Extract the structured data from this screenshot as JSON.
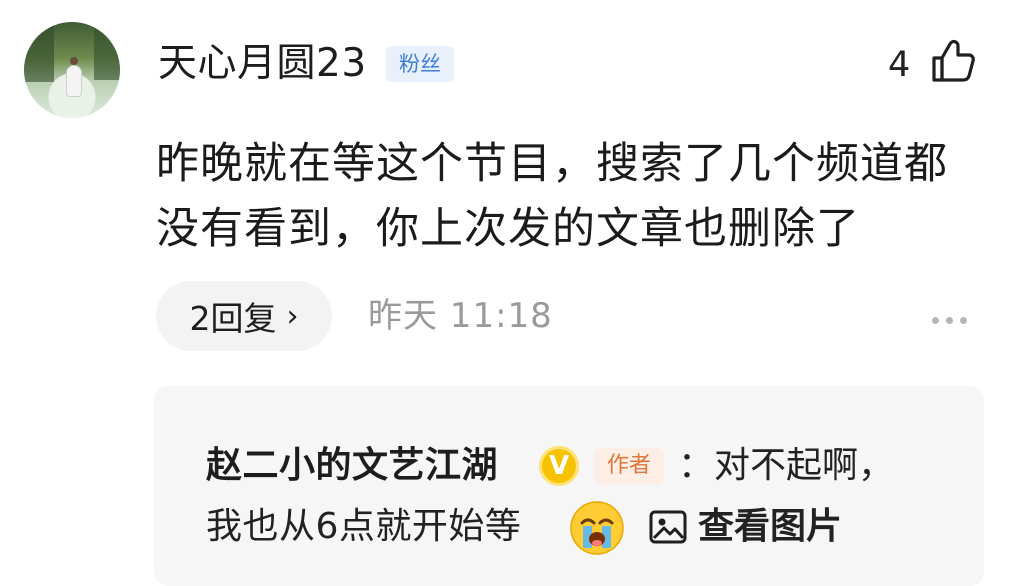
{
  "comment": {
    "username": "天心月圆23",
    "badge": "粉丝",
    "like_count": "4",
    "like_icon": "thumbs-up-icon",
    "text": "昨晚就在等这个节目，搜索了几个频道都没有看到，你上次发的文章也删除了",
    "replies_label": "2回复",
    "replies_chevron": "›",
    "time": "昨天  11:18",
    "more_icon": "more-dots-icon"
  },
  "reply": {
    "author": "赵二小的文艺江湖",
    "verified_symbol": "V",
    "author_tag": "作者",
    "line1": "：对不起啊，",
    "line2": "我也从6点就开始等",
    "emoji": "crying-face-emoji",
    "view_image_icon": "image-icon",
    "view_image_label": "查看图片"
  },
  "colors": {
    "badge_text": "#3f7fd6",
    "badge_bg": "#e7f0fb",
    "author_tag_text": "#e0773a",
    "verified": "#f7c200",
    "muted_text": "#9a9a9a"
  }
}
